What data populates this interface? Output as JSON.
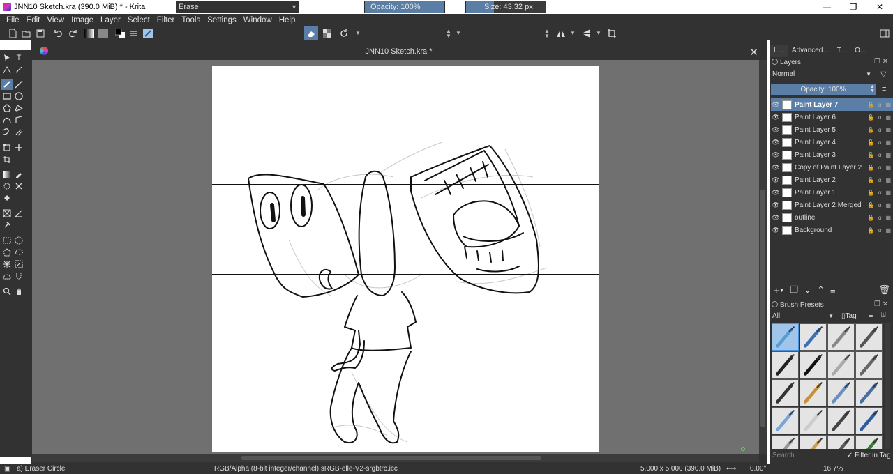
{
  "window": {
    "title": "JNN10 Sketch.kra (390.0 MiB)  * - Krita",
    "minimize": "—",
    "maximize": "❐",
    "close": "✕"
  },
  "menu": [
    "File",
    "Edit",
    "View",
    "Image",
    "Layer",
    "Select",
    "Filter",
    "Tools",
    "Settings",
    "Window",
    "Help"
  ],
  "toolbar": {
    "preset_name": "Erase",
    "opacity_label": "Opacity: 100%",
    "opacity_value": 1.0,
    "size_label": "Size: 43.32 px",
    "size_fill_fraction": 0.35
  },
  "document": {
    "tab_title": "JNN10 Sketch.kra *",
    "close": "✕"
  },
  "dock": {
    "tabs": [
      "L...",
      "Advanced...",
      "T...",
      "O..."
    ],
    "layers_panel": {
      "title": "Layers",
      "blend_mode": "Normal",
      "opacity_label": "Opacity:  100%",
      "layers": [
        {
          "name": "Paint Layer 7",
          "active": true,
          "locked": false
        },
        {
          "name": "Paint Layer 6",
          "active": false,
          "locked": false
        },
        {
          "name": "Paint Layer 5",
          "active": false,
          "locked": false
        },
        {
          "name": "Paint Layer 4",
          "active": false,
          "locked": false
        },
        {
          "name": "Paint Layer 3",
          "active": false,
          "locked": false
        },
        {
          "name": "Copy of Paint Layer 2",
          "active": false,
          "locked": false
        },
        {
          "name": "Paint Layer 2",
          "active": false,
          "locked": false
        },
        {
          "name": "Paint Layer 1",
          "active": false,
          "locked": false
        },
        {
          "name": "Paint Layer 2 Merged",
          "active": false,
          "locked": false
        },
        {
          "name": "outline",
          "active": false,
          "locked": false
        },
        {
          "name": "Background",
          "active": false,
          "locked": true
        }
      ]
    },
    "brush_presets": {
      "title": "Brush Presets",
      "filter": "All",
      "tag_label": "Tag",
      "search_placeholder": "Search",
      "filter_in_tag": "Filter in Tag"
    }
  },
  "status": {
    "tool": "a) Eraser Circle",
    "color_space": "RGB/Alpha (8-bit integer/channel)  sRGB-elle-V2-srgbtrc.icc",
    "image_size": "5,000 x 5,000 (390.0 MiB)",
    "rotation": "0.00°",
    "zoom": "16.7%"
  },
  "colors": {
    "background": "#323232",
    "canvas_bg": "#707070",
    "accent": "#5b7ea7"
  }
}
